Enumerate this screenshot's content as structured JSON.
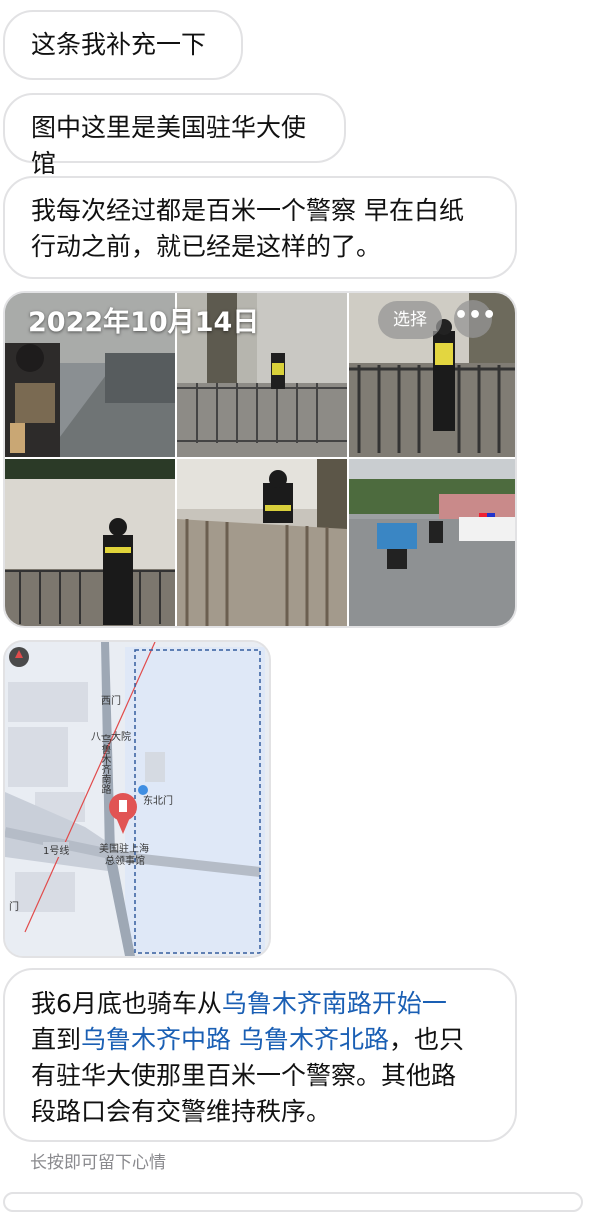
{
  "messages": {
    "m1": "这条我补充一下",
    "m2": "图中这里是美国驻华大使馆",
    "m3_line1": "我每次经过都是百米一个警察 早在白纸",
    "m3_line2": "行动之前，就已经是这样的了。"
  },
  "album": {
    "date": "2022年10月14日",
    "select_label": "选择",
    "more_label": "•••",
    "photos": [
      "street-cyclist",
      "fence-guard",
      "guard-standing",
      "wall-guard",
      "guard-by-fence",
      "intersection-police-car"
    ]
  },
  "map": {
    "road_vertical": "乌鲁木齐南路",
    "gate": "东北门",
    "place": "八一大院",
    "west_gate": "西门",
    "poi_line1": "美国驻上海",
    "poi_line2": "总领事馆",
    "metro": "1号线",
    "gate_left": "门"
  },
  "final": {
    "l1a": "我6月底也骑车从",
    "l1b": "乌鲁木齐南路开始一",
    "l2a": "直到",
    "l2b": "乌鲁木齐中路",
    "l2c": " ",
    "l2d": "乌鲁木齐北路",
    "l2e": "，也只",
    "l3": "有驻华大使那里百米一个警察。其他路",
    "l4": "段路口会有交警维持秩序。"
  },
  "hint": "长按即可留下心情",
  "colors": {
    "link": "#1a5fb4",
    "bubble_border": "#e2e2e4"
  }
}
